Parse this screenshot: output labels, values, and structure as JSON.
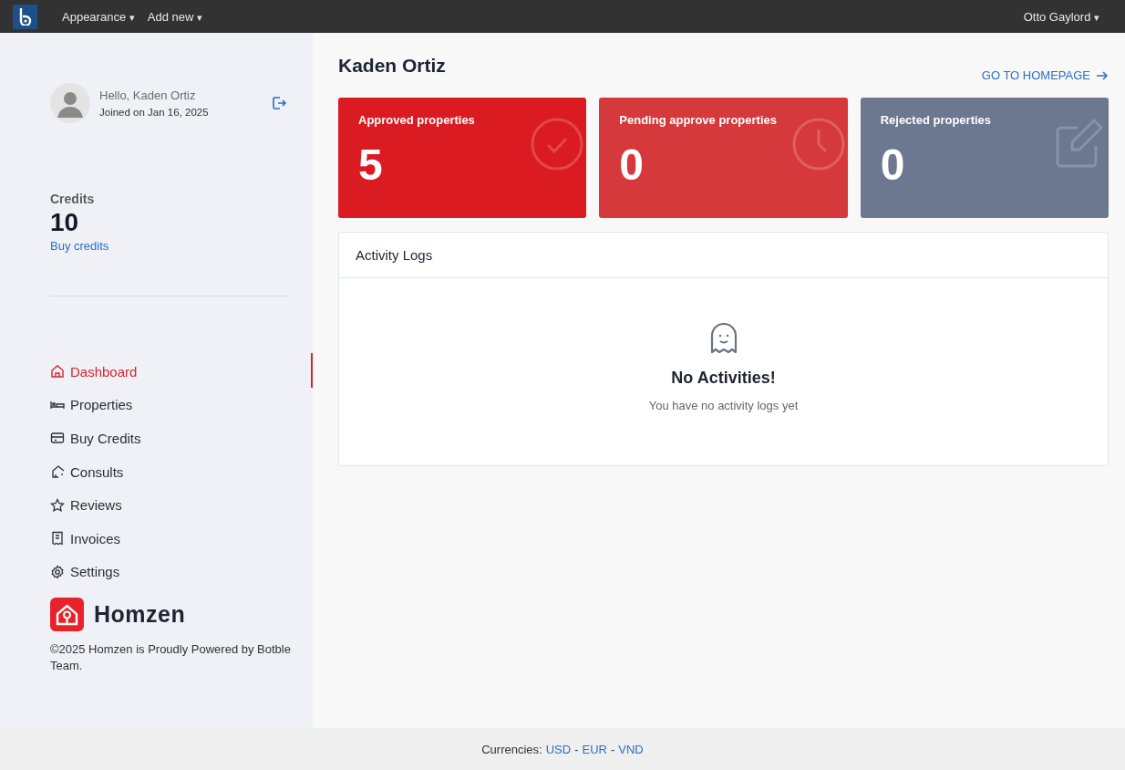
{
  "topbar": {
    "menus": [
      {
        "label": "Appearance",
        "caret": "▾"
      },
      {
        "label": "Add new",
        "caret": "▾"
      }
    ],
    "user": {
      "label": "Otto Gaylord",
      "caret": "▾"
    }
  },
  "profile": {
    "greeting": "Hello, Kaden Ortiz",
    "joined": "Joined on Jan 16, 2025"
  },
  "credits": {
    "label": "Credits",
    "value": "10",
    "link": "Buy credits"
  },
  "nav": [
    {
      "label": "Dashboard",
      "kind": "home",
      "selected": true
    },
    {
      "label": "Properties",
      "kind": "bed",
      "selected": false
    },
    {
      "label": "Buy Credits",
      "kind": "card",
      "selected": false
    },
    {
      "label": "Consults",
      "kind": "consult",
      "selected": false
    },
    {
      "label": "Reviews",
      "kind": "star",
      "selected": false
    },
    {
      "label": "Invoices",
      "kind": "invoice",
      "selected": false
    },
    {
      "label": "Settings",
      "kind": "gear",
      "selected": false
    }
  ],
  "brand": {
    "name": "Homzen",
    "copyright": "©2025 Homzen is Proudly Powered by Botble Team."
  },
  "page": {
    "title": "Kaden Ortiz",
    "homepage_link": "GO TO HOMEPAGE"
  },
  "stats": [
    {
      "label": "Approved properties",
      "value": "5",
      "kind": "check",
      "color": "#da1b22"
    },
    {
      "label": "Pending approve properties",
      "value": "0",
      "kind": "clock",
      "color": "#d6393b"
    },
    {
      "label": "Rejected properties",
      "value": "0",
      "kind": "edit",
      "color": "#6b788f"
    }
  ],
  "activity": {
    "title": "Activity Logs",
    "empty_title": "No Activities!",
    "empty_text": "You have no activity logs yet"
  },
  "footer": {
    "label": "Currencies:",
    "currencies": [
      "USD",
      "EUR",
      "VND"
    ],
    "separator": "-"
  }
}
